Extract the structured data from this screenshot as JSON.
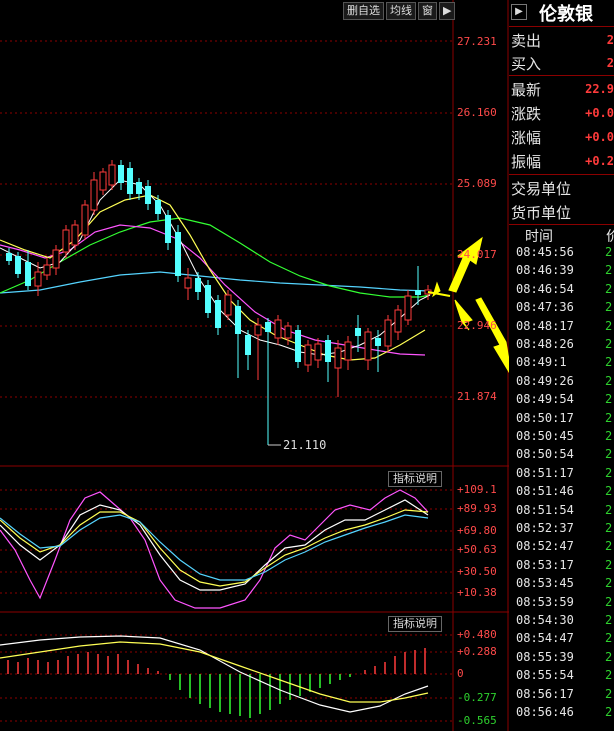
{
  "toolbar": {
    "delete_option_label": "删自选",
    "average_line_label": "均线",
    "window_label": "窗"
  },
  "price_axis": {
    "levels": [
      "27.231",
      "26.160",
      "25.089",
      "24.017",
      "22.946",
      "21.874"
    ],
    "low_marker": "21.110"
  },
  "indicator1": {
    "button_label": "指标说明",
    "levels": [
      "+109.1",
      "+89.93",
      "+69.80",
      "+50.63",
      "+30.50",
      "+10.38"
    ]
  },
  "indicator2": {
    "button_label": "指标说明",
    "levels": [
      "+0.480",
      "+0.288",
      "0",
      "-0.277",
      "-0.565"
    ]
  },
  "quote_panel": {
    "title": "伦敦银",
    "rows": [
      {
        "label": "卖出",
        "value": "2"
      },
      {
        "label": "买入",
        "value": "2"
      },
      {
        "label": "最新",
        "value": "22.9"
      },
      {
        "label": "涨跌",
        "value": "+0.0"
      },
      {
        "label": "涨幅",
        "value": "+0.0"
      },
      {
        "label": "振幅",
        "value": "+0.2"
      },
      {
        "label": "交易单位",
        "value": ""
      },
      {
        "label": "货币单位",
        "value": ""
      }
    ],
    "tick_header_time": "时间",
    "tick_header_price": "价",
    "ticks": [
      {
        "time": "08:45:56",
        "price": "2"
      },
      {
        "time": "08:46:39",
        "price": "2"
      },
      {
        "time": "08:46:54",
        "price": "2"
      },
      {
        "time": "08:47:36",
        "price": "2"
      },
      {
        "time": "08:48:17",
        "price": "2"
      },
      {
        "time": "08:48:26",
        "price": "2"
      },
      {
        "time": "08:49:1",
        "price": "2"
      },
      {
        "time": "08:49:26",
        "price": "2"
      },
      {
        "time": "08:49:54",
        "price": "2"
      },
      {
        "time": "08:50:17",
        "price": "2"
      },
      {
        "time": "08:50:45",
        "price": "2"
      },
      {
        "time": "08:50:54",
        "price": "2"
      },
      {
        "time": "08:51:17",
        "price": "2"
      },
      {
        "time": "08:51:46",
        "price": "2"
      },
      {
        "time": "08:51:54",
        "price": "2"
      },
      {
        "time": "08:52:37",
        "price": "2"
      },
      {
        "time": "08:52:47",
        "price": "2"
      },
      {
        "time": "08:53:17",
        "price": "2"
      },
      {
        "time": "08:53:45",
        "price": "2"
      },
      {
        "time": "08:53:59",
        "price": "2"
      },
      {
        "time": "08:54:30",
        "price": "2"
      },
      {
        "time": "08:54:47",
        "price": "2"
      },
      {
        "time": "08:55:39",
        "price": "2"
      },
      {
        "time": "08:55:54",
        "price": "2"
      },
      {
        "time": "08:56:17",
        "price": "2"
      },
      {
        "time": "08:56:46",
        "price": "2"
      }
    ]
  },
  "colors": {
    "background": "#000000",
    "grid": "#8b0000",
    "bull_candle": "#ff3b3b",
    "bear_candle": "#54ffff",
    "ma_yellow": "#ffff55",
    "ma_magenta": "#ff55ff",
    "ma_cyan": "#55d4ff",
    "ma_green": "#33ff33",
    "arrow": "#ffff00",
    "tick_value": "#2ed12e"
  }
}
